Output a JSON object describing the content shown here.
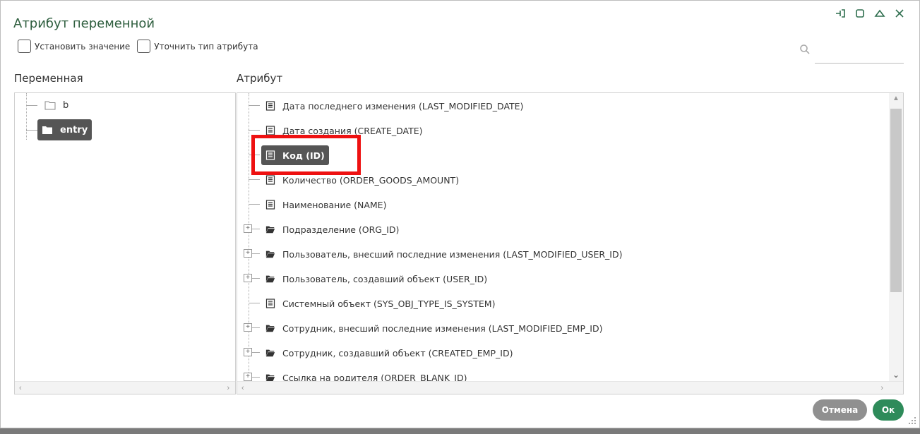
{
  "dialog": {
    "title": "Атрибут переменной"
  },
  "window_controls": [
    "pin-icon",
    "maximize-icon",
    "collapse-icon",
    "close-icon"
  ],
  "options": {
    "set_value_label": "Установить значение",
    "refine_type_label": "Уточнить тип атрибута"
  },
  "search": {
    "value": "",
    "placeholder": ""
  },
  "variable_panel": {
    "header": "Переменная",
    "nodes": [
      {
        "label": "b",
        "icon": "folder-outline-icon",
        "selected": false
      },
      {
        "label": "entry",
        "icon": "folder-icon",
        "selected": true
      }
    ]
  },
  "attribute_panel": {
    "header": "Атрибут",
    "items": [
      {
        "label": "Дата последнего изменения (LAST_MODIFIED_DATE)",
        "icon": "list-icon",
        "expandable": false,
        "selected": false
      },
      {
        "label": "Дата создания (CREATE_DATE)",
        "icon": "list-icon",
        "expandable": false,
        "selected": false
      },
      {
        "label": "Код (ID)",
        "icon": "list-icon",
        "expandable": false,
        "selected": true
      },
      {
        "label": "Количество (ORDER_GOODS_AMOUNT)",
        "icon": "list-icon",
        "expandable": false,
        "selected": false
      },
      {
        "label": "Наименование (NAME)",
        "icon": "list-icon",
        "expandable": false,
        "selected": false
      },
      {
        "label": "Подразделение (ORG_ID)",
        "icon": "open-folder-icon",
        "expandable": true,
        "selected": false
      },
      {
        "label": "Пользователь, внесший последние изменения (LAST_MODIFIED_USER_ID)",
        "icon": "open-folder-icon",
        "expandable": true,
        "selected": false
      },
      {
        "label": "Пользователь, создавший объект (USER_ID)",
        "icon": "open-folder-icon",
        "expandable": true,
        "selected": false
      },
      {
        "label": "Системный объект (SYS_OBJ_TYPE_IS_SYSTEM)",
        "icon": "list-icon",
        "expandable": false,
        "selected": false
      },
      {
        "label": "Сотрудник, внесший последние изменения (LAST_MODIFIED_EMP_ID)",
        "icon": "open-folder-icon",
        "expandable": true,
        "selected": false
      },
      {
        "label": "Сотрудник, создавший объект (CREATED_EMP_ID)",
        "icon": "open-folder-icon",
        "expandable": true,
        "selected": false
      },
      {
        "label": "Ссылка на родителя (ORDER_BLANK_ID)",
        "icon": "open-folder-icon",
        "expandable": true,
        "selected": false
      }
    ]
  },
  "footer": {
    "cancel_label": "Отмена",
    "ok_label": "Ок"
  },
  "colors": {
    "accent": "#2e8b5a",
    "title": "#2e5e3e",
    "selection": "#555555",
    "highlight": "#ee1111"
  }
}
